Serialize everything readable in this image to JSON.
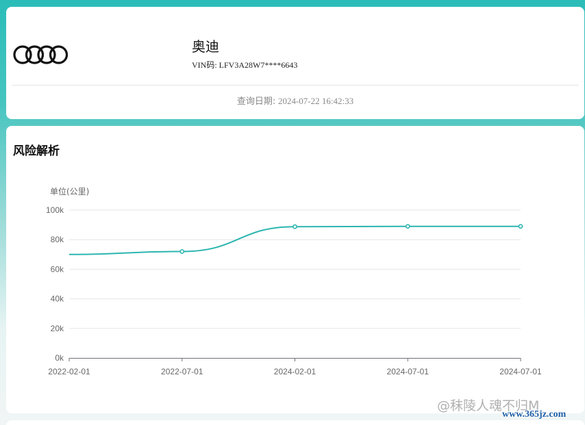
{
  "vehicle": {
    "brand": "奥迪",
    "vin_label": "VIN码:",
    "vin": "LFV3A28W7****6643",
    "logo_icon": "audi-rings-icon"
  },
  "query": {
    "label": "查询日期:",
    "value": "2024-07-22 16:42:33"
  },
  "risk": {
    "title": "风险解析"
  },
  "chart_data": {
    "type": "line",
    "title": "",
    "ylabel": "单位(公里)",
    "xlabel": "",
    "categories": [
      "2022-02-01",
      "2022-07-01",
      "2024-02-01",
      "2024-07-01",
      "2024-07-01"
    ],
    "series": [
      {
        "values": [
          70000,
          72000,
          88800,
          89000,
          89000
        ]
      }
    ],
    "ylim": [
      0,
      100000
    ],
    "yticks": [
      0,
      20000,
      40000,
      60000,
      80000,
      100000
    ],
    "ytick_labels": [
      "0k",
      "20k",
      "40k",
      "60k",
      "80k",
      "100k"
    ],
    "smooth": true,
    "grid": true,
    "color": "#2bb5b0"
  },
  "watermark": {
    "text": "@秣陵人魂不归M",
    "url": "www.365jz.com"
  },
  "colors": {
    "accent": "#2bb5b0",
    "background_top": "#2bbdb9"
  }
}
